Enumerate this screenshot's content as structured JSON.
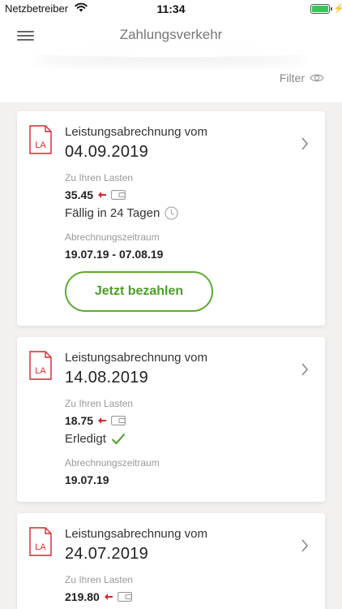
{
  "status_bar": {
    "carrier": "Netzbetreiber",
    "time": "11:34",
    "battery_percent": 100,
    "charging": true
  },
  "header": {
    "title": "Zahlungsverkehr",
    "filter_label": "Filter"
  },
  "colors": {
    "accent_green": "#5aac2f",
    "document_red": "#d9262c",
    "background": "#f2f1ef"
  },
  "invoices": [
    {
      "icon_text": "LA",
      "heading": "Leistungsabrechnung vom",
      "date": "04.09.2019",
      "charge_label": "Zu Ihren Lasten",
      "amount": "35.45",
      "status": "Fällig in 24 Tagen",
      "status_icon": "clock-icon",
      "period_label": "Abrechnungszeitraum",
      "period": "19.07.19 - 07.08.19",
      "pay_button_label": "Jetzt bezahlen"
    },
    {
      "icon_text": "LA",
      "heading": "Leistungsabrechnung vom",
      "date": "14.08.2019",
      "charge_label": "Zu Ihren Lasten",
      "amount": "18.75",
      "status": "Erledigt",
      "status_icon": "checkmark-icon",
      "period_label": "Abrechnungszeitraum",
      "period": "19.07.19"
    },
    {
      "icon_text": "LA",
      "heading": "Leistungsabrechnung vom",
      "date": "24.07.2019",
      "charge_label": "Zu Ihren Lasten",
      "amount": "219.80"
    }
  ]
}
